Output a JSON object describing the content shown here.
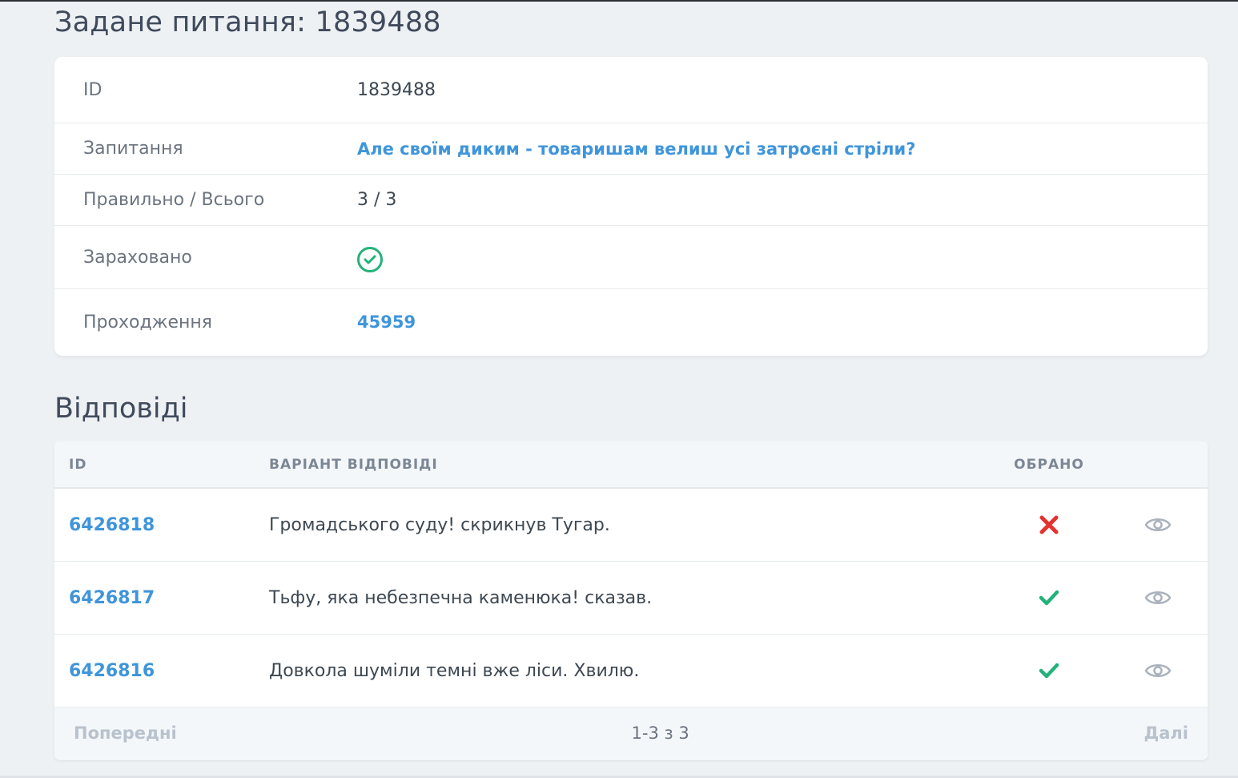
{
  "page": {
    "title": "Задане питання: 1839488"
  },
  "details": {
    "id_label": "ID",
    "id_value": "1839488",
    "question_label": "Запитання",
    "question_value": "Але своїм диким - товаришам велиш усі затроєні стріли?",
    "score_label": "Правильно / Всього",
    "score_value": "3 / 3",
    "credited_label": "Зараховано",
    "credited_icon": "check-circle-icon",
    "attempt_label": "Проходження",
    "attempt_value": "45959"
  },
  "answers": {
    "title": "Відповіді",
    "columns": {
      "id": "ID",
      "text": "ВАРІАНТ ВІДПОВІДІ",
      "chosen": "ОБРАНО"
    },
    "rows": [
      {
        "id": "6426818",
        "text": "Громадського суду! скрикнув Тугар.",
        "chosen": false
      },
      {
        "id": "6426817",
        "text": "Тьфу, яка небезпечна каменюка! сказав.",
        "chosen": true
      },
      {
        "id": "6426816",
        "text": "Довкола шуміли темні вже ліси. Хвилю.",
        "chosen": true
      }
    ],
    "pagination": {
      "prev": "Попередні",
      "info": "1-3 з 3",
      "next": "Далі"
    }
  },
  "colors": {
    "accent": "#3f95db",
    "success": "#23b279",
    "danger": "#e3342f"
  }
}
